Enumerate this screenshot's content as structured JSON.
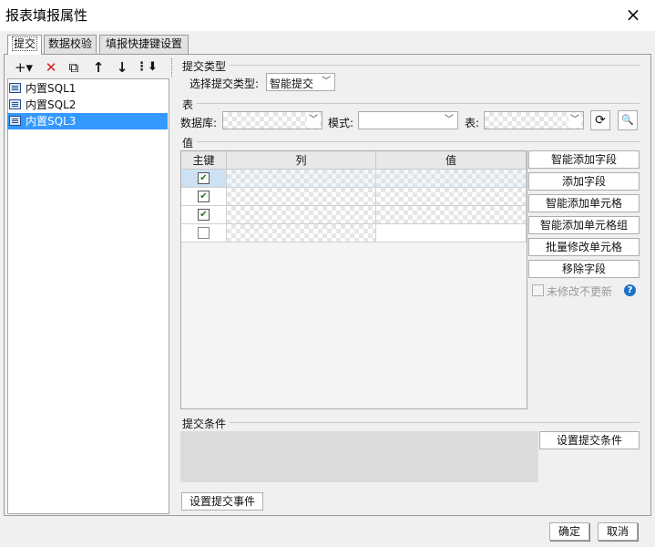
{
  "window": {
    "title": "报表填报属性",
    "close_icon": "×"
  },
  "tabs": [
    {
      "label": "提交"
    },
    {
      "label": "数据校验"
    },
    {
      "label": "填报快捷键设置"
    }
  ],
  "toolbar": {
    "add": "+▾",
    "delete": "✕",
    "copy": "⧉",
    "up": "↑",
    "down": "↓",
    "more": "⋮⬇"
  },
  "sql_list": [
    {
      "label": "内置SQL1"
    },
    {
      "label": "内置SQL2"
    },
    {
      "label": "内置SQL3",
      "selected": true
    }
  ],
  "submit_type": {
    "section": "提交类型",
    "label": "选择提交类型:",
    "value": "智能提交"
  },
  "table": {
    "section": "表",
    "database_label": "数据库:",
    "database_value": "",
    "schema_label": "模式:",
    "schema_value": "",
    "table_label": "表:",
    "table_value": "",
    "refresh_icon": "⟳",
    "preview_icon": "🔍"
  },
  "values": {
    "section": "值",
    "headers": [
      "主键",
      "列",
      "值"
    ],
    "rows": [
      {
        "key": true,
        "column": "",
        "value": ""
      },
      {
        "key": true,
        "column": "",
        "value": ""
      },
      {
        "key": true,
        "column": "",
        "value": ""
      },
      {
        "key": false,
        "column": "",
        "value": ""
      }
    ]
  },
  "side_buttons": [
    "智能添加字段",
    "添加字段",
    "智能添加单元格",
    "智能添加单元格组",
    "批量修改单元格",
    "移除字段"
  ],
  "no_change_no_update": "未修改不更新",
  "help_icon": "?",
  "condition": {
    "section": "提交条件",
    "button": "设置提交条件"
  },
  "event_button": "设置提交事件",
  "footer": {
    "ok": "确定",
    "cancel": "取消"
  },
  "colors": {
    "selection": "#3399ff",
    "accent": "#1a73c7"
  }
}
